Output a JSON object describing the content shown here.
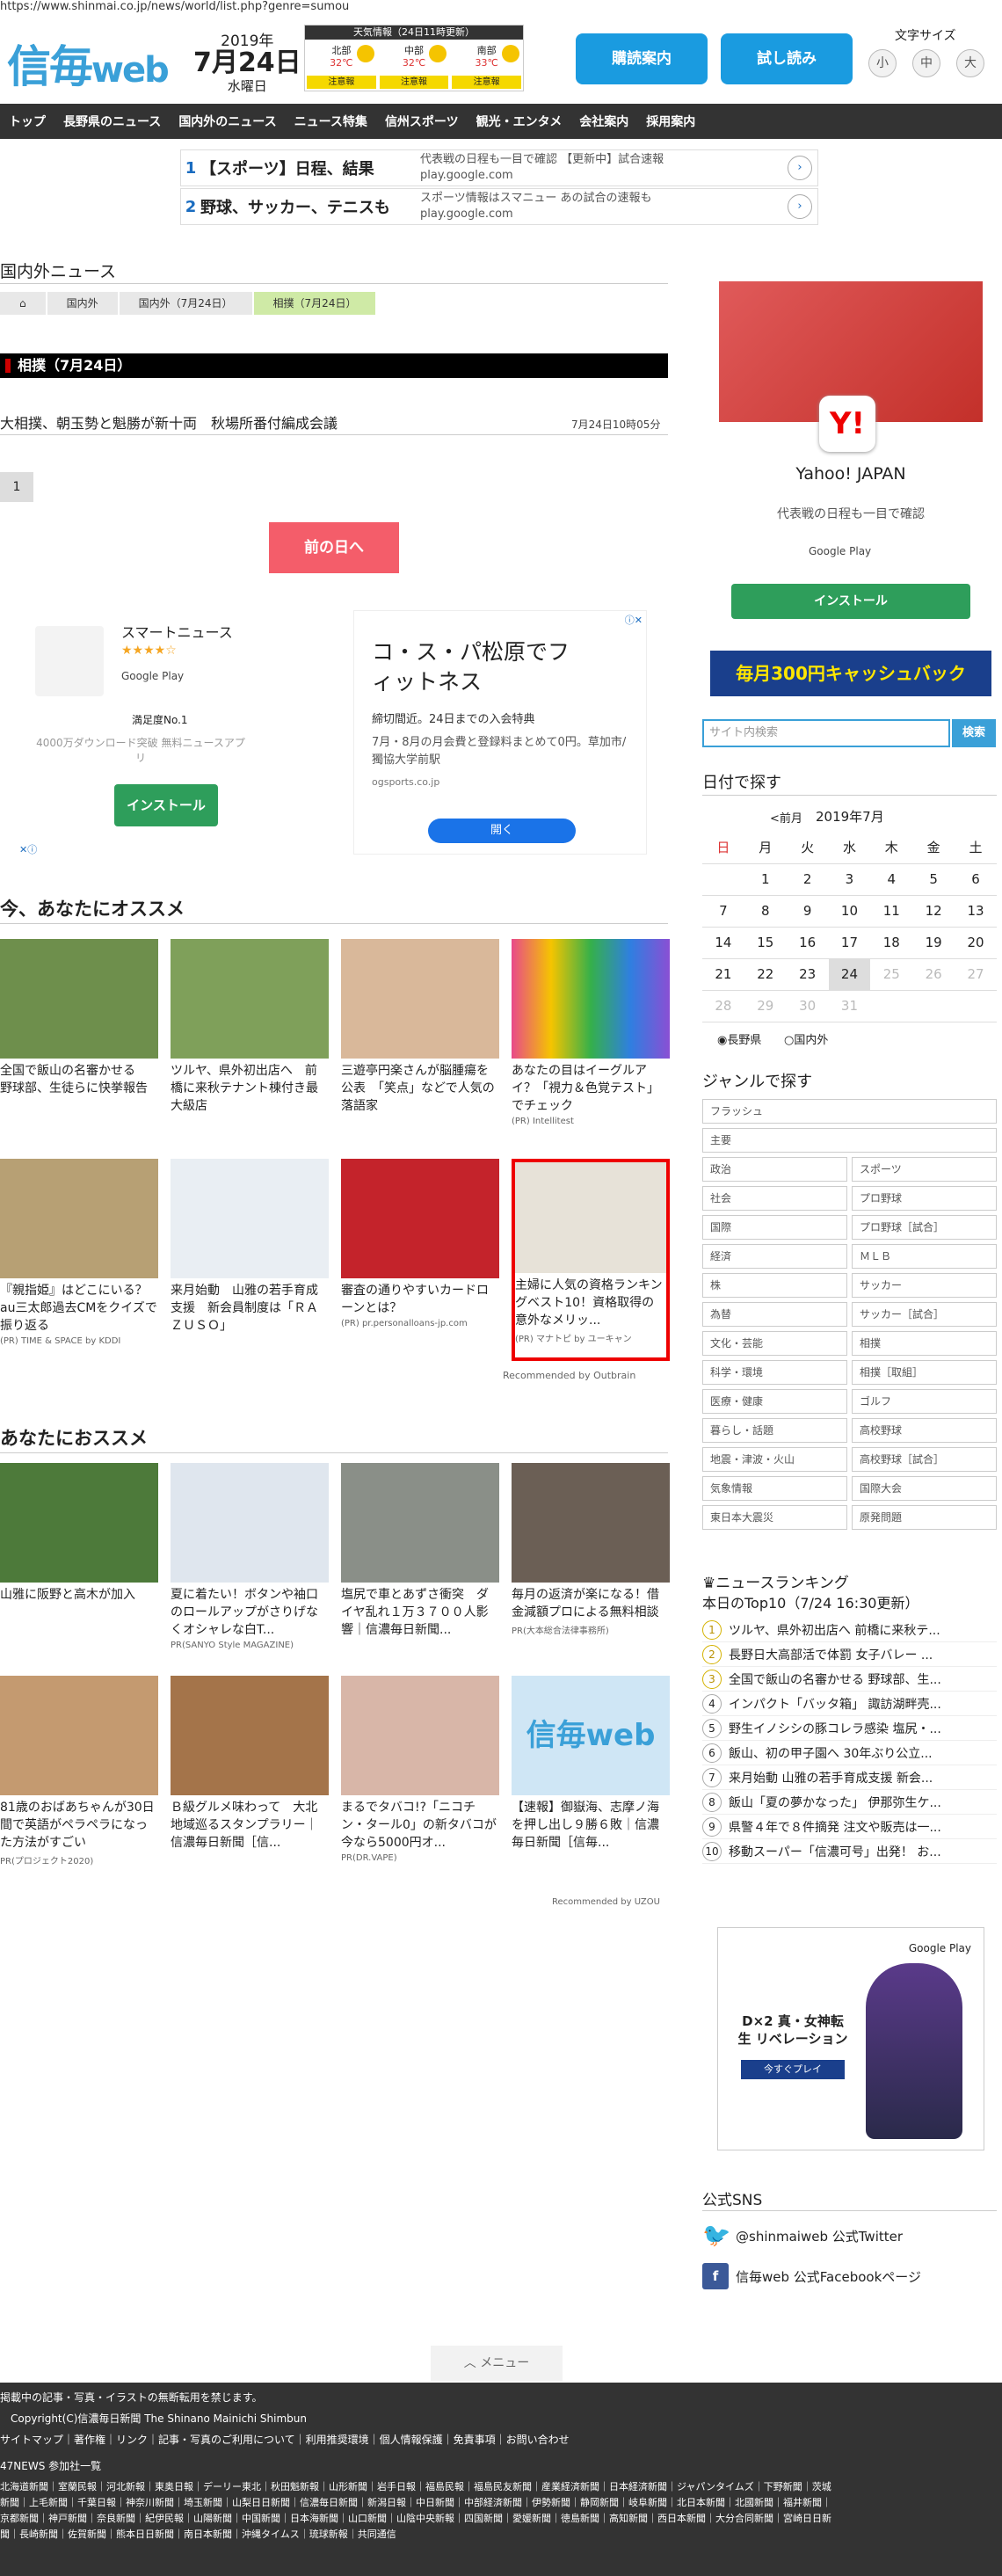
{
  "url": "https://www.shinmai.co.jp/news/world/list.php?genre=sumou",
  "logo": {
    "main": "信毎",
    "sub": "web"
  },
  "date": {
    "year": "2019年",
    "day": "7月24日",
    "weekday": "水曜日"
  },
  "weather": {
    "title": "天気情報（24日11時更新）",
    "areas": [
      {
        "name": "北部",
        "temp": "32℃",
        "warn": "注意報"
      },
      {
        "name": "中部",
        "temp": "32℃",
        "warn": "注意報"
      },
      {
        "name": "南部",
        "temp": "33℃",
        "warn": "注意報"
      }
    ]
  },
  "header_buttons": {
    "subscribe": "購読案内",
    "trial": "試し読み"
  },
  "font_size": {
    "label": "文字サイズ",
    "small": "小",
    "medium": "中",
    "large": "大"
  },
  "nav": [
    "トップ",
    "長野県のニュース",
    "国内外のニュース",
    "ニュース特集",
    "信州スポーツ",
    "観光・エンタメ",
    "会社案内",
    "採用案内"
  ],
  "top_ads": [
    {
      "num": "1",
      "title": "【スポーツ】日程、結果",
      "desc1": "代表戦の日程も一目で確認 【更新中】試合速報",
      "desc2": "play.google.com"
    },
    {
      "num": "2",
      "title": "野球、サッカー、テニスも",
      "desc1": "スポーツ情報はスマニュー あの試合の速報も",
      "desc2": "play.google.com"
    }
  ],
  "section": "国内外ニュース",
  "breadcrumb": [
    "国内外",
    "国内外（7月24日）",
    "相撲（7月24日）"
  ],
  "category_bar": "相撲（7月24日）",
  "article": {
    "title": "大相撲、朝玉勢と魁勝が新十両　秋場所番付編成会議",
    "time": "7月24日10時05分"
  },
  "pagination": {
    "current": "1",
    "prev": "前の日へ"
  },
  "app_ad": {
    "name": "スマートニュース",
    "store": "Google Play",
    "rating": "満足度No.1",
    "desc": "4000万ダウンロード突破 無料ニュースアプリ",
    "install": "インストール"
  },
  "gym_ad": {
    "title": "コ・ス・パ松原でフィットネス",
    "line1": "締切間近。24日までの入会特典",
    "line2": "7月・8月の月会費と登録料まとめて0円。草加市/獨協大学前駅",
    "domain": "ogsports.co.jp",
    "open": "開く"
  },
  "reco_title": "今、あなたにオススメ",
  "reco_cards": [
    {
      "cap": "全国で飯山の名審かせる　野球部、生徒らに快挙報告",
      "pr": ""
    },
    {
      "cap": "ツルヤ、県外初出店へ　前橋に来秋テナント棟付き最大級店",
      "pr": ""
    },
    {
      "cap": "三遊亭円楽さんが脳腫瘍を公表　「笑点」などで人気の落語家",
      "pr": ""
    },
    {
      "cap": "あなたの目はイーグルアイ？「視力＆色覚テスト」でチェック",
      "pr": "(PR) Intellitest"
    },
    {
      "cap": "『親指姫』はどこにいる？ au三太郎過去CMをクイズで振り返る",
      "pr": "(PR) TIME & SPACE by KDDI"
    },
    {
      "cap": "来月始動　山雅の若手育成支援　新会員制度は「ＲＡＺＵＳＯ」",
      "pr": ""
    },
    {
      "cap": "審査の通りやすいカードローンとは？",
      "pr": "(PR) pr.personalloans-jp.com"
    },
    {
      "cap": "主婦に人気の資格ランキングベスト10！資格取得の意外なメリッ...",
      "pr": "(PR) マナトピ by ユーキャン"
    }
  ],
  "recommended_by": "Recommended by Outbrain",
  "for_you_title": "あなたにおススメ",
  "for_you_cards": [
    {
      "cap": "山雅に阪野と高木が加入",
      "pr": ""
    },
    {
      "cap": "夏に着たい！ボタンや袖口のロールアップがさりげなくオシャレな白T...",
      "pr": "PR(SANYO Style MAGAZINE)"
    },
    {
      "cap": "塩尻で車とあずさ衝突　ダイヤ乱れ１万３７００人影響｜信濃毎日新聞...",
      "pr": ""
    },
    {
      "cap": "毎月の返済が楽になる！借金減額プロによる無料相談",
      "pr": "PR(大本総合法律事務所)"
    },
    {
      "cap": "81歳のおばあちゃんが30日間で英語がペラペラになった方法がすごい",
      "pr": "PR(プロジェクト2020)"
    },
    {
      "cap": "Ｂ級グルメ味わって　大北地域巡るスタンプラリー｜信濃毎日新聞［信...",
      "pr": ""
    },
    {
      "cap": "まるでタバコ!?「ニコチン・タール0」の新タバコが今なら5000円オ...",
      "pr": "PR(DR.VAPE)"
    },
    {
      "cap": "【速報】御嶽海、志摩ノ海を押し出し９勝６敗｜信濃毎日新聞［信毎...",
      "pr": ""
    }
  ],
  "uzou": "Recommended by UZOU",
  "side_ad": {
    "brand": "Yahoo! JAPAN",
    "desc": "代表戦の日程も一目で確認",
    "store": "Google Play",
    "install": "インストール"
  },
  "premium_banner": "毎月300円キャッシュバック",
  "search": {
    "placeholder": "サイト内検索",
    "button": "検索"
  },
  "calendar": {
    "title": "日付で探す",
    "prev": "<前月",
    "month": "2019年7月",
    "weekdays": [
      "日",
      "月",
      "火",
      "水",
      "木",
      "金",
      "土"
    ],
    "weeks": [
      [
        "",
        "1",
        "2",
        "3",
        "4",
        "5",
        "6"
      ],
      [
        "7",
        "8",
        "9",
        "10",
        "11",
        "12",
        "13"
      ],
      [
        "14",
        "15",
        "16",
        "17",
        "18",
        "19",
        "20"
      ],
      [
        "21",
        "22",
        "23",
        "24",
        "25",
        "26",
        "27"
      ],
      [
        "28",
        "29",
        "30",
        "31",
        "",
        "",
        ""
      ]
    ],
    "radio1": "長野県",
    "radio2": "国内外"
  },
  "genre": {
    "title": "ジャンルで探す",
    "single": [
      "フラッシュ",
      "主要"
    ],
    "pairs": [
      [
        "政治",
        "スポーツ"
      ],
      [
        "社会",
        "プロ野球"
      ],
      [
        "国際",
        "プロ野球［試合］"
      ],
      [
        "経済",
        "ＭＬＢ"
      ],
      [
        "株",
        "サッカー"
      ],
      [
        "為替",
        "サッカー［試合］"
      ],
      [
        "文化・芸能",
        "相撲"
      ],
      [
        "科学・環境",
        "相撲［取組］"
      ],
      [
        "医療・健康",
        "ゴルフ"
      ],
      [
        "暮らし・話題",
        "高校野球"
      ],
      [
        "地震・津波・火山",
        "高校野球［試合］"
      ],
      [
        "気象情報",
        "国際大会"
      ],
      [
        "東日本大震災",
        "原発問題"
      ]
    ]
  },
  "ranking": {
    "title": "ニュースランキング",
    "sub": "本日のTop10（7/24 16:30更新）",
    "items": [
      "ツルヤ、県外初出店へ 前橋に来秋テ...",
      "長野日大高部活で体罰 女子バレー ...",
      "全国で飯山の名審かせる 野球部、生...",
      "インパクト「バッタ箱」 諏訪湖畔壳...",
      "野生イノシシの豚コレラ感染 塩尻・...",
      "飯山、初の甲子園へ 30年ぶり公立...",
      "来月始動 山雅の若手育成支援 新会...",
      "飯山「夏の夢かなった」 伊那弥生ケ...",
      "県警４年で８件摘発 注文や販売は一...",
      "移動スーパー「信濃可号」出発！ お..."
    ]
  },
  "game_ad": {
    "store": "Google Play",
    "title": "D×2 真・女神転生 リベレーション",
    "play": "今すぐプレイ"
  },
  "sns": {
    "title": "公式SNS",
    "twitter": "@shinmaiweb 公式Twitter",
    "facebook": "信毎web 公式Facebookページ"
  },
  "menu": "メニュー",
  "footer": {
    "notice": "掲載中の記事・写真・イラストの無断転用を禁じます。",
    "copyright": "Copyright(C)信濃毎日新聞 The Shinano Mainichi Shimbun",
    "links": "サイトマップ｜著作権｜リンク｜記事・写真のご利用について｜利用推奨環境｜個人情報保護｜免責事項｜お問い合わせ",
    "members_title": "47NEWS 参加社一覧",
    "members1": "北海道新聞｜室蘭民報｜河北新報｜東奥日報｜デーリー東北｜秋田魁新報｜山形新聞｜岩手日報｜福島民報｜福島民友新聞｜産業経済新聞｜日本経済新聞｜ジャパンタイムズ｜下野新聞｜茨城",
    "members2": "新聞｜上毛新聞｜千葉日報｜神奈川新聞｜埼玉新聞｜山梨日日新聞｜信濃毎日新聞｜新潟日報｜中日新聞｜中部経済新聞｜伊勢新聞｜静岡新聞｜岐阜新聞｜北日本新聞｜北國新聞｜福井新聞｜",
    "members3": "京都新聞｜神戸新聞｜奈良新聞｜紀伊民報｜山陽新聞｜中国新聞｜日本海新聞｜山口新聞｜山陰中央新報｜四国新聞｜愛媛新聞｜徳島新聞｜高知新聞｜西日本新聞｜大分合同新聞｜宮崎日日新",
    "members4": "聞｜長崎新聞｜佐賀新聞｜熊本日日新聞｜南日本新聞｜沖縄タイムス｜琉球新報｜共同通信"
  },
  "colors": {
    "brand": "#3aa0d8",
    "nav": "#333333",
    "accent": "#f45d6a"
  }
}
